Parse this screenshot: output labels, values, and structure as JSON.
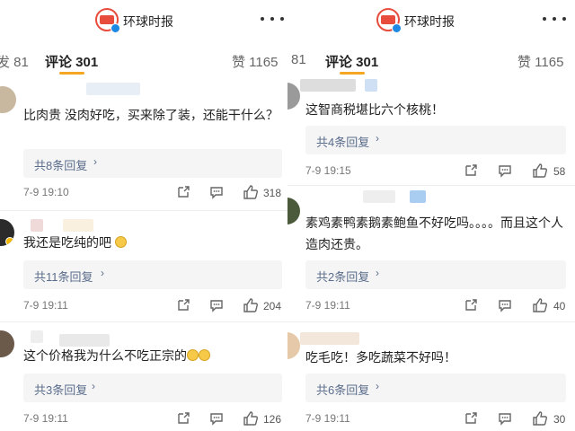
{
  "left": {
    "brand": "环球时报",
    "tab_prev": "发 81",
    "tab_comments": "评论 301",
    "tab_likes": "赞 1165",
    "comments": [
      {
        "text": "比肉贵 没肉好吃，买来除了装，还能干什么？",
        "replies": "共8条回复",
        "time": "7-9 19:10",
        "likes": "318"
      },
      {
        "text": "我还是吃纯的吧",
        "replies": "共11条回复",
        "time": "7-9 19:11",
        "likes": "204"
      },
      {
        "text": "这个价格我为什么不吃正宗的",
        "replies": "共3条回复",
        "time": "7-9 19:11",
        "likes": "126"
      }
    ]
  },
  "right": {
    "brand": "环球时报",
    "tab_prev": "81",
    "tab_comments": "评论 301",
    "tab_likes": "赞 1165",
    "comments": [
      {
        "text": "这智商税堪比六个核桃！",
        "replies": "共4条回复",
        "time": "7-9 19:15",
        "likes": "58"
      },
      {
        "text": "素鸡素鸭素鹅素鲍鱼不好吃吗。。。。而且这个人造肉还贵。",
        "replies": "共2条回复",
        "time": "7-9 19:11",
        "likes": "40"
      },
      {
        "text": "吃毛吃！多吃蔬菜不好吗！",
        "replies": "共6条回复",
        "time": "7-9 19:11",
        "likes": "30"
      }
    ]
  },
  "icons": [
    "more-icon",
    "share-icon",
    "comment-icon",
    "like-icon",
    "chevron-right-icon"
  ],
  "colors": {
    "accent": "#f5a623",
    "reply_link": "#5b6d8c",
    "brand_red": "#e84c3d"
  }
}
